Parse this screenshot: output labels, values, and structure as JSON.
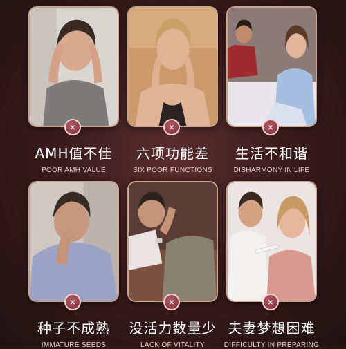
{
  "cards": [
    {
      "title": "AMH值不佳",
      "subtitle": "POOR AMH VALUE",
      "badge": "×",
      "icon": "close-icon"
    },
    {
      "title": "六项功能差",
      "subtitle": "SIX POOR FUNCTIONS",
      "badge": "×",
      "icon": "close-icon"
    },
    {
      "title": "生活不和谐",
      "subtitle": "DISHARMONY IN LIFE",
      "badge": "×",
      "icon": "close-icon"
    },
    {
      "title": "种子不成熟",
      "subtitle": "IMMATURE SEEDS",
      "badge": "×",
      "icon": "close-icon"
    },
    {
      "title": "没活力数量少",
      "subtitle": "LACK OF VITALITY",
      "badge": "×",
      "icon": "close-icon"
    },
    {
      "title": "夫妻梦想困难",
      "subtitle": "DIFFICULTY IN PREPARING",
      "badge": "×",
      "icon": "close-icon"
    }
  ],
  "colors": {
    "background": "#3a1c1d",
    "border": "#caa38d",
    "badge": "#7e2d38",
    "title": "#ffffff",
    "subtitle": "#e7cfcf"
  }
}
